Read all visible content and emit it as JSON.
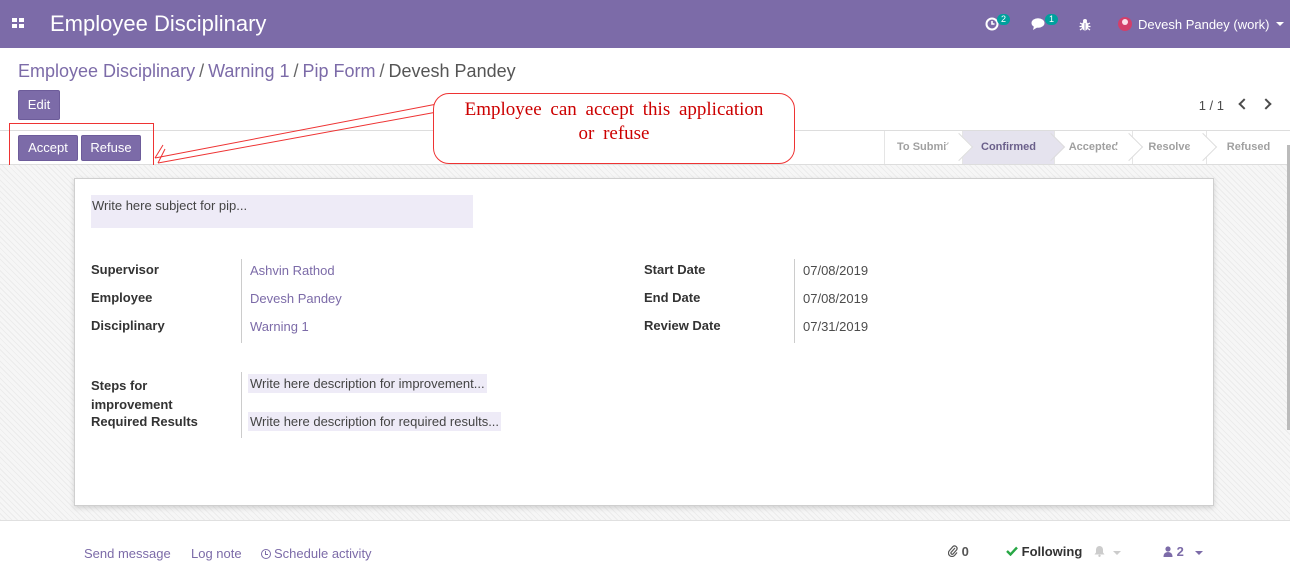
{
  "navbar": {
    "app_title": "Employee Disciplinary",
    "activity_badge": "2",
    "messages_badge": "1",
    "user_name": "Devesh Pandey (work)"
  },
  "breadcrumb": {
    "items": [
      "Employee Disciplinary",
      "Warning 1",
      "Pip Form"
    ],
    "current": "Devesh Pandey",
    "separator": "/"
  },
  "control": {
    "edit_label": "Edit",
    "pager": "1 / 1"
  },
  "header": {
    "accept_label": "Accept",
    "refuse_label": "Refuse",
    "stages": [
      {
        "label": "To Submit",
        "current": false
      },
      {
        "label": "Confirmed",
        "current": true
      },
      {
        "label": "Accepted",
        "current": false
      },
      {
        "label": "Resolve",
        "current": false
      },
      {
        "label": "Refused",
        "current": false
      }
    ]
  },
  "annotation": {
    "line1": "Employee can accept this application",
    "line2": "or refuse"
  },
  "form": {
    "subject_placeholder": "Write here subject for pip...",
    "left_fields": [
      {
        "label": "Supervisor",
        "value": "Ashvin Rathod"
      },
      {
        "label": "Employee",
        "value": "Devesh Pandey"
      },
      {
        "label": "Disciplinary",
        "value": "Warning 1"
      }
    ],
    "right_fields": [
      {
        "label": "Start Date",
        "value": "07/08/2019"
      },
      {
        "label": "End Date",
        "value": "07/08/2019"
      },
      {
        "label": "Review Date",
        "value": "07/31/2019"
      }
    ],
    "steps_label_1": "Steps for",
    "steps_label_2": "improvement",
    "steps_placeholder": "Write here description for improvement...",
    "required_label": "Required Results",
    "required_placeholder": "Write here description for required results..."
  },
  "chatter": {
    "send_message": "Send message",
    "log_note": "Log note",
    "schedule_activity": "Schedule activity",
    "attachments_count": "0",
    "following_label": "Following",
    "followers_count": "2"
  },
  "colors": {
    "brand": "#7c6ba8",
    "annotation_red": "#e33",
    "following_green": "#28a745"
  }
}
